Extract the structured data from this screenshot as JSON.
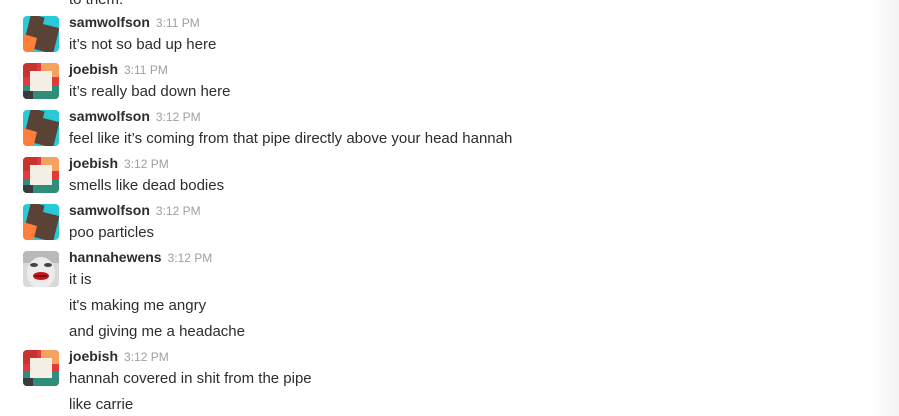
{
  "partial_line": "to them.",
  "messages": [
    {
      "user": "samwolfson",
      "avatar": "samwolfson-avatar",
      "time": "3:11 PM",
      "lines": [
        "it’s not so bad up here"
      ]
    },
    {
      "user": "joebish",
      "avatar": "joebish-avatar",
      "time": "3:11 PM",
      "lines": [
        "it’s really bad down here"
      ]
    },
    {
      "user": "samwolfson",
      "avatar": "samwolfson-avatar",
      "time": "3:12 PM",
      "lines": [
        "feel like it’s coming from that pipe directly above your head hannah"
      ]
    },
    {
      "user": "joebish",
      "avatar": "joebish-avatar",
      "time": "3:12 PM",
      "lines": [
        "smells like dead bodies"
      ]
    },
    {
      "user": "samwolfson",
      "avatar": "samwolfson-avatar",
      "time": "3:12 PM",
      "lines": [
        "poo particles"
      ]
    },
    {
      "user": "hannahewens",
      "avatar": "hannahewens-avatar",
      "time": "3:12 PM",
      "lines": [
        "it is",
        "it's making me angry",
        "and giving me a headache"
      ]
    },
    {
      "user": "joebish",
      "avatar": "joebish-avatar",
      "time": "3:12 PM",
      "lines": [
        "hannah covered in shit from the pipe",
        "like carrie"
      ]
    }
  ],
  "colors": {
    "username": "#2c2d30",
    "timestamp": "#9e9ea6",
    "text": "#2c2d30",
    "background": "#ffffff"
  }
}
